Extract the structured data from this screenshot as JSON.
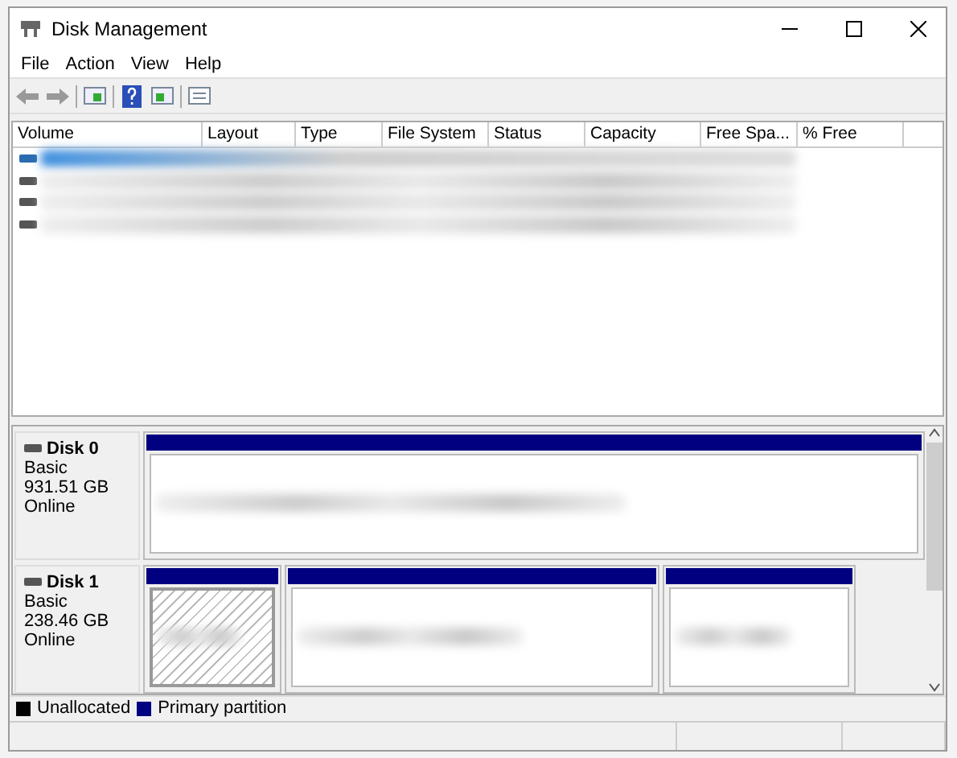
{
  "window": {
    "title": "Disk Management"
  },
  "menu": [
    "File",
    "Action",
    "View",
    "Help"
  ],
  "volumes": {
    "columns": [
      "Volume",
      "Layout",
      "Type",
      "File System",
      "Status",
      "Capacity",
      "Free Spa...",
      "% Free"
    ],
    "rows": [
      {
        "selected": true
      },
      {
        "selected": false
      },
      {
        "selected": false
      },
      {
        "selected": false
      }
    ]
  },
  "disks": [
    {
      "name": "Disk 0",
      "type": "Basic",
      "size": "931.51 GB",
      "status": "Online",
      "partitions": [
        {
          "selected": false
        }
      ]
    },
    {
      "name": "Disk 1",
      "type": "Basic",
      "size": "238.46 GB",
      "status": "Online",
      "partitions": [
        {
          "selected": true
        },
        {
          "selected": false
        },
        {
          "selected": false
        }
      ]
    }
  ],
  "legend": [
    {
      "label": "Unallocated",
      "color": "#000000"
    },
    {
      "label": "Primary partition",
      "color": "#000080"
    }
  ]
}
